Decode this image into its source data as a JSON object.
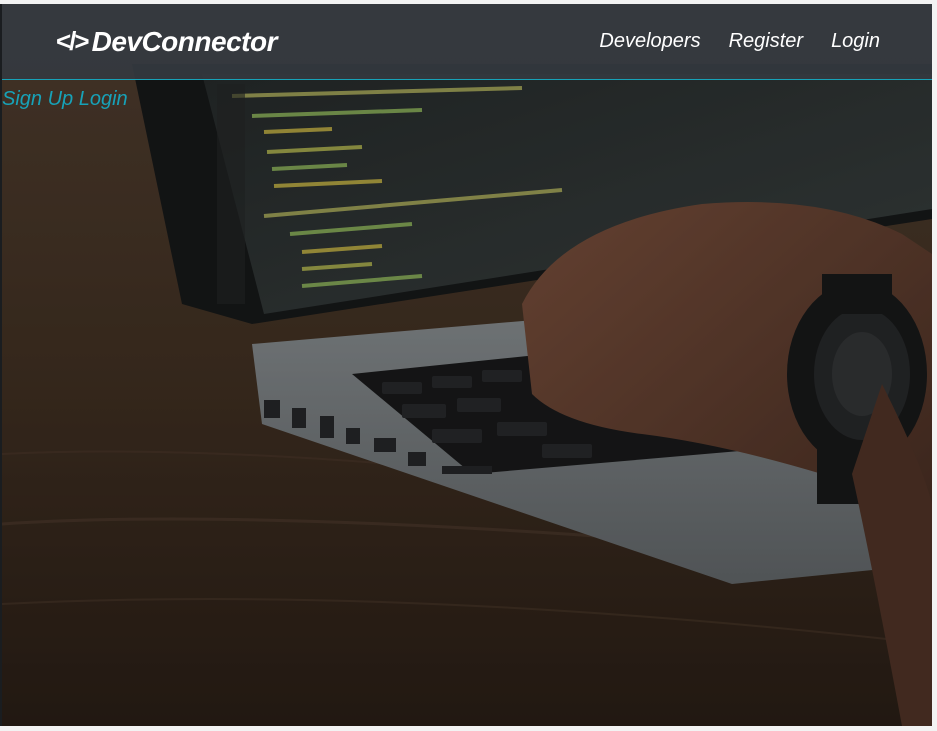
{
  "navbar": {
    "brand_icon": "</>",
    "brand_name": "DevConnector",
    "links": [
      {
        "label": "Developers"
      },
      {
        "label": "Register"
      },
      {
        "label": "Login"
      }
    ]
  },
  "landing": {
    "signup_label": "Sign Up",
    "login_label": "Login"
  },
  "colors": {
    "accent": "#17a2b8",
    "navbar_bg": "#343a40"
  }
}
